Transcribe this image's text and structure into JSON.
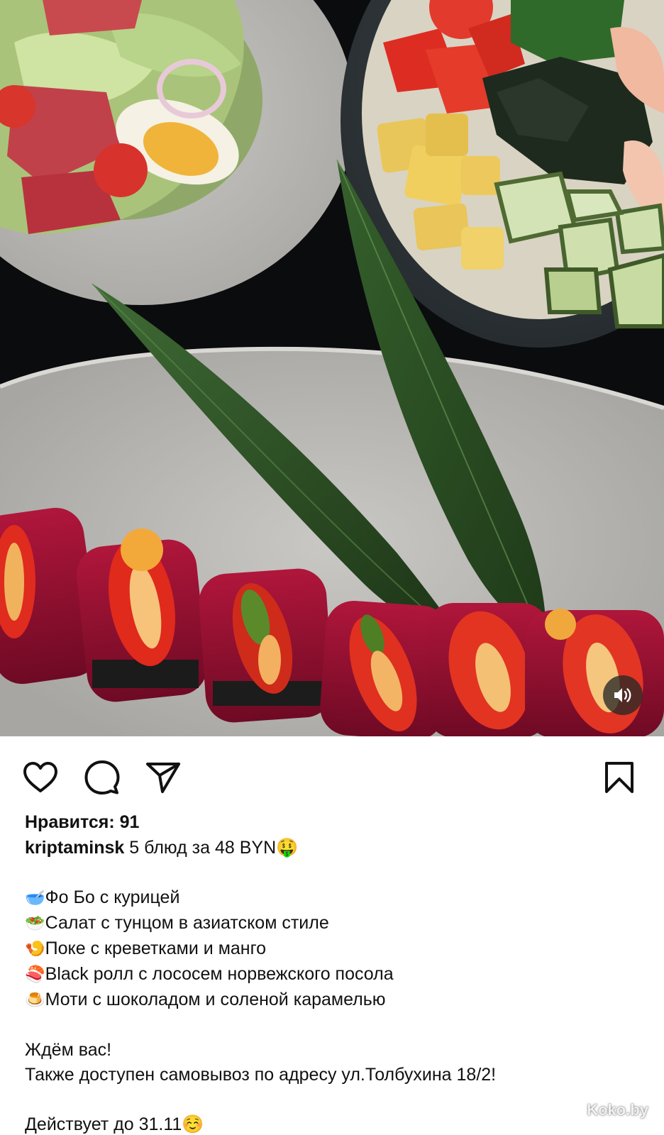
{
  "post": {
    "likes_label": "Нравится: 91",
    "username": "kriptaminsk",
    "headline": "5 блюд за 48 BYN🤑",
    "menu_items": [
      {
        "emoji": "🥣",
        "text": "Фо Бо с курицей"
      },
      {
        "emoji": "🥗",
        "text": "Салат с тунцом в азиатском стиле"
      },
      {
        "emoji": "🍤",
        "text": "Поке с креветками и манго"
      },
      {
        "emoji": "🍣",
        "text": "Black ролл с лососем норвежского посола"
      },
      {
        "emoji": "🍮",
        "text": "Моти с шоколадом и соленой карамелью"
      }
    ],
    "closing_line_1": "Ждём вас!",
    "closing_line_2": "Также доступен самовывоз по адресу ул.Толбухина 18/2!",
    "validity": "Действует до 31.11☺️"
  },
  "media": {
    "sound_icon": "speaker-volume-icon"
  },
  "actions": {
    "icons": [
      "heart-icon",
      "comment-icon",
      "share-icon",
      "bookmark-icon"
    ]
  },
  "watermark": "Koko.by"
}
